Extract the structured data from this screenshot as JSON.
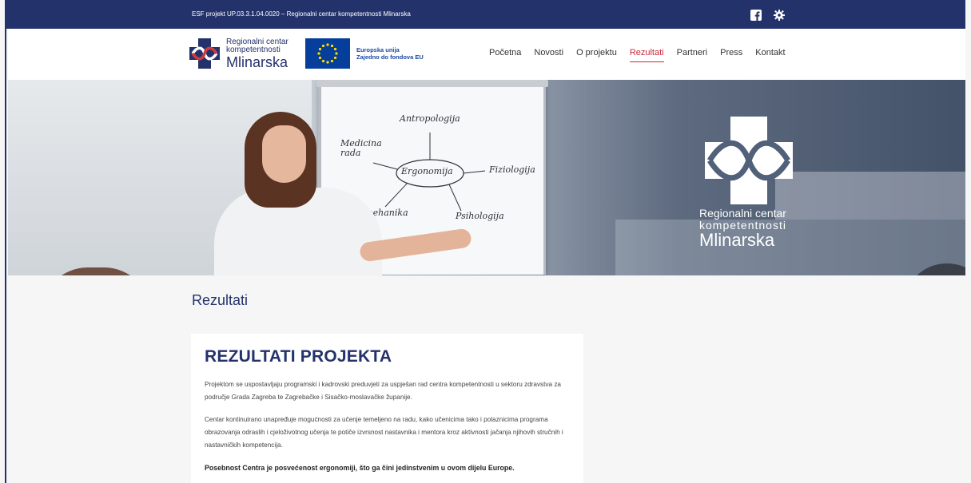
{
  "topbar": {
    "info_text": "ESF projekt UP.03.3.1.04.0020 – Regionalni centar kompetentnosti Mlinarska",
    "social_icons": [
      "facebook-icon",
      "gear-icon"
    ]
  },
  "header": {
    "logo": {
      "line1": "Regionalni centar",
      "line2": "kompetentnosti",
      "line3": "Mlinarska"
    },
    "eu": {
      "line1": "Europska unija",
      "line2": "Zajedno do fondova EU"
    },
    "nav": [
      {
        "label": "Početna"
      },
      {
        "label": "Novosti"
      },
      {
        "label": "O projektu"
      },
      {
        "label": "Rezultati"
      },
      {
        "label": "Partneri"
      },
      {
        "label": "Press"
      },
      {
        "label": "Kontakt"
      }
    ],
    "active_nav": "Rezultati"
  },
  "hero": {
    "flipchart": {
      "center": "Ergonomija",
      "words": [
        "Antropologija",
        "Medicina rada",
        "Fiziologija",
        "Biomehanika",
        "Psihologija"
      ]
    },
    "logo": {
      "line1": "Regionalni centar",
      "line2": "kompetentnosti",
      "line3": "Mlinarska"
    }
  },
  "main": {
    "page_title": "Rezultati",
    "card": {
      "heading": "REZULTATI PROJEKTA",
      "paragraphs": [
        "Projektom se uspostavljaju programski i kadrovski preduvjeti za uspješan rad centra kompetentnosti u sektoru zdravstva za područje Grada Zagreba te Zagrebačke i Sisačko-moslavačke županije.",
        "Centar kontinuirano unapređuje mogućnosti za učenje temeljeno na radu, kako učenicima tako i polaznicima programa obrazovanja odraslih i cjeloživotnog učenja te potiče izvrsnost nastavnika i mentora kroz aktivnosti jačanja njihovih stručnih i nastavničkih kompetencija.",
        "Posebnost Centra je posvećenost ergonomiji, što ga čini jedinstvenim u ovom dijelu Europe."
      ]
    }
  },
  "colors": {
    "primary": "#24326b",
    "accent": "#c8283c",
    "background": "#f6f6f7"
  }
}
